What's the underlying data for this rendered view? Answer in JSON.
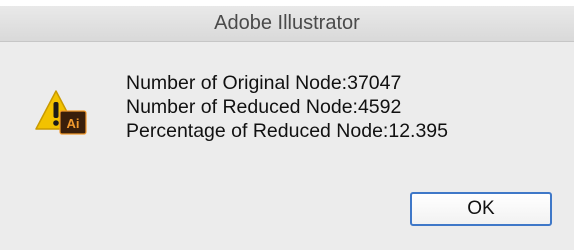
{
  "window": {
    "title": "Adobe Illustrator"
  },
  "icon": {
    "name": "warning-illustrator-icon",
    "badge_text": "Ai",
    "warning_color": "#f2c200",
    "badge_bg": "#3a1f0b",
    "badge_fg": "#f29a2e"
  },
  "messages": [
    "Number of Original Node:37047",
    "Number of Reduced Node:4592",
    "Percentage of Reduced Node:12.395"
  ],
  "buttons": {
    "ok_label": "OK"
  },
  "colors": {
    "accent": "#3f78c8"
  }
}
